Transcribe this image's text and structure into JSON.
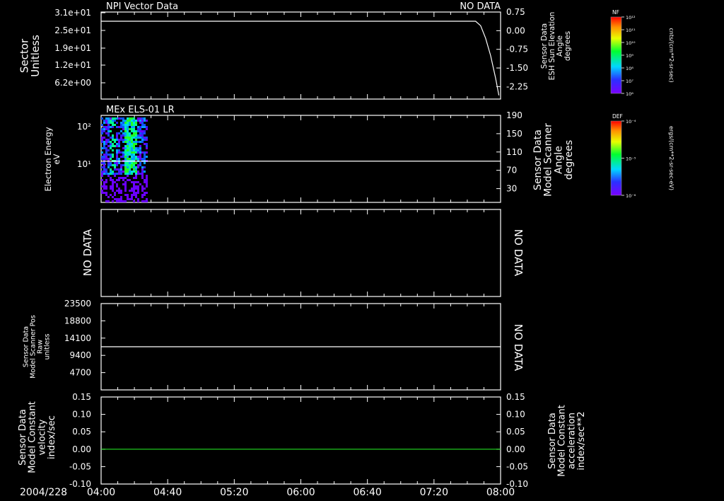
{
  "colors": {
    "frame": "#ffffff",
    "background": "#000000",
    "green": "#22dd22"
  },
  "time_axis": {
    "date_label": "2004/228",
    "ticks": [
      "04:00",
      "04:40",
      "05:20",
      "06:00",
      "06:40",
      "07:20",
      "08:00"
    ]
  },
  "colorbars": [
    {
      "title": "NF",
      "units": "cnts/(cm**2-sr-sec)",
      "tick_labels": [
        "10¹²",
        "10¹¹",
        "10¹⁰",
        "10⁹",
        "10⁸",
        "10⁷",
        "10⁶"
      ]
    },
    {
      "title": "DEF",
      "units": "ergs/(cm**2-sr-sec-eV)",
      "tick_labels": [
        "10⁻⁴",
        "10⁻⁵",
        "10⁻⁶"
      ]
    }
  ],
  "chart_data": [
    {
      "type": "line",
      "title_left": "NPI Vector Data",
      "title_right": "NO DATA",
      "ylabel_left": [
        "Sector",
        "Unitless"
      ],
      "ytick_left": [
        "3.1e+01",
        "2.5e+01",
        "1.9e+01",
        "1.2e+01",
        "6.2e+00"
      ],
      "ylabel_right": [
        "Sensor Data",
        "ESH Sun Elevation",
        "Angle",
        "degrees"
      ],
      "ytick_right": [
        "0.75",
        "0.00",
        "-0.75",
        "-1.50",
        "-2.25"
      ],
      "ylim_right": [
        -2.75,
        0.75
      ],
      "series": [
        {
          "axis": "right",
          "color": "#ffffff",
          "x": [
            "04:00",
            "07:45",
            "07:48",
            "07:51",
            "07:54",
            "07:57",
            "07:59"
          ],
          "y": [
            0.38,
            0.38,
            0.2,
            -0.3,
            -1.0,
            -1.9,
            -2.6
          ]
        }
      ]
    },
    {
      "type": "heatmap",
      "title_left": "MEx ELS-01 LR",
      "ylabel_left": [
        "Electron Energy",
        "eV"
      ],
      "ytick_left": [
        "10²",
        "10¹"
      ],
      "ylabel_right": [
        "Sensor Data",
        "Model Scanner",
        "Angle",
        "degrees"
      ],
      "ytick_right": [
        "190",
        "150",
        "110",
        "70",
        "30"
      ],
      "ylim_right": [
        0,
        190
      ],
      "overlay_line": {
        "axis": "right",
        "value": 90,
        "color": "#ffffff"
      },
      "data_time_range": [
        "04:00",
        "04:28"
      ]
    },
    {
      "type": "line",
      "left_text": "NO DATA",
      "right_text": "NO DATA"
    },
    {
      "type": "line",
      "ylabel_left": [
        "Sensor Data",
        "Model Scanner Pos",
        "Raw",
        "unitless"
      ],
      "ytick_left": [
        "23500",
        "18800",
        "14100",
        "9400",
        "4700"
      ],
      "ylim_left": [
        0,
        23500
      ],
      "right_text": "NO DATA",
      "series": [
        {
          "axis": "left",
          "color": "#ffffff",
          "x": [
            "04:00",
            "08:00"
          ],
          "y": [
            11750,
            11750
          ]
        }
      ]
    },
    {
      "type": "line",
      "ylabel_left": [
        "Sensor Data",
        "Model Constant",
        "velocity",
        "index/sec"
      ],
      "ytick_left": [
        "0.15",
        "0.10",
        "0.05",
        "0.00",
        "-0.05",
        "-0.10"
      ],
      "ylim_left": [
        -0.1,
        0.15
      ],
      "ylabel_right": [
        "Sensor Data",
        "Model Constant",
        "acceleration",
        "index/sec**2"
      ],
      "ytick_right": [
        "0.15",
        "0.10",
        "0.05",
        "0.00",
        "-0.05",
        "-0.10"
      ],
      "ylim_right": [
        -0.1,
        0.15
      ],
      "series": [
        {
          "axis": "left",
          "color": "#22dd22",
          "x": [
            "04:00",
            "08:00"
          ],
          "y": [
            0.0,
            0.0
          ]
        }
      ]
    }
  ]
}
